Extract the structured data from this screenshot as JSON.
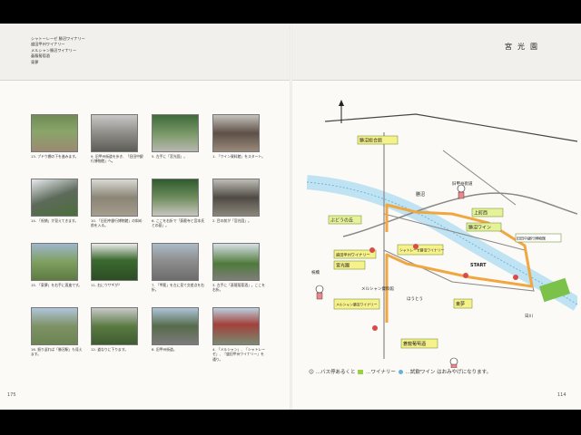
{
  "header": {
    "lines": [
      "シャトーレーゼ 勝沼ワイナリー",
      "盛田甲州ワイナリー",
      "メルシャン勝沼ワイナリー",
      "蒼龍葡萄酒",
      "東夢"
    ],
    "page_title": "宮光園"
  },
  "photos": [
    {
      "caption": "13. ブドウ棚の下を進みます。"
    },
    {
      "caption": "9. 旧甲州街道を歩き、「旧田中銀行博物館」へ。"
    },
    {
      "caption": "5. 左手に「宮光園」。"
    },
    {
      "caption": "1. 「ワイン資料館」をスタート。"
    },
    {
      "caption": "14. 「祝橋」が見えてきます。"
    },
    {
      "caption": "10. 「旧田中銀行博物館」の斜め前を入る。"
    },
    {
      "caption": "6. ここを右折で「蒼龍寺と宮本氏との墓」。"
    },
    {
      "caption": "2. 目の前が「宮光園」。"
    },
    {
      "caption": "15. 「東夢」を右手に直進です。"
    },
    {
      "caption": "11. 右にウサギが？"
    },
    {
      "caption": "7. 「甲龍」を左に見て交差点を右折。"
    },
    {
      "caption": "3. 左手に「蒼龍葡萄酒」。ここを右折。"
    },
    {
      "caption": "16. 振り返れば「勝沼駅」も見えます。"
    },
    {
      "caption": "12. 道なりに下ります。"
    },
    {
      "caption": "8. 旧甲州街道。"
    },
    {
      "caption": "4. 「メルシャン」、「シャトレーゼ」、「盛田甲州ワイナリー」を通り。"
    }
  ],
  "map": {
    "labels": {
      "kaikan": "勝沼総合館",
      "cafe_ebisuya": "ぶどうの丘",
      "kurashikan": "勝沼ワイン",
      "hoto": "ほうとう",
      "kamihan": "上町西",
      "chateraise": "シャトレーゼ勝沼ワイナリー",
      "morita": "盛田甲州ワイナリー",
      "miyakoen": "宮光園",
      "mercian": "メルシャン勝沼ワイナリー",
      "mercian_ref": "メルシャン資料館",
      "ginko": "旧田中銀行博物館",
      "soryu": "蒼龍葡萄酒",
      "tomu": "東夢",
      "station_road": "勝沼",
      "kofu_road": "旧甲州街道",
      "river": "日川",
      "bridge": "祝橋",
      "start": "START"
    }
  },
  "legend": {
    "text_prefix": "…バス停あるくと",
    "text_mid": "…ワイナリー",
    "text_wine": "…試飲ワイン",
    "text_suffix": "はおみやげになります。"
  },
  "footer": {
    "page_left": "175",
    "page_right": "114"
  }
}
